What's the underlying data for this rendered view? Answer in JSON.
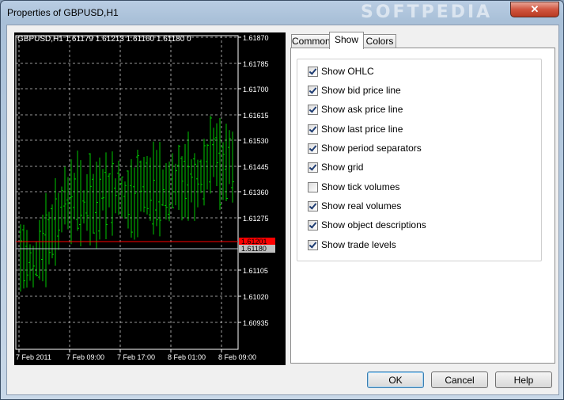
{
  "window": {
    "title": "Properties of GBPUSD,H1",
    "watermark": "SOFTPEDIA",
    "close_label": "✕"
  },
  "chart": {
    "header": "GBPUSD,H1  1.61179 1.61213 1.61160 1.61180  0",
    "price_labels": [
      "1.61870",
      "1.61785",
      "1.61700",
      "1.61615",
      "1.61530",
      "1.61445",
      "1.61360",
      "1.61275",
      "1.61105",
      "1.61020",
      "1.60935"
    ],
    "time_labels": [
      "7 Feb 2011",
      "7 Feb 09:00",
      "7 Feb 17:00",
      "8 Feb 01:00",
      "8 Feb 09:00"
    ],
    "bid_label": "1.61201",
    "last_label": "1.61180",
    "colors": {
      "bars": "#00c800",
      "bid": "#ff0000",
      "grid": "#c8c8c8",
      "background": "#000000"
    }
  },
  "tabs": [
    {
      "label": "Common",
      "active": false
    },
    {
      "label": "Show",
      "active": true
    },
    {
      "label": "Colors",
      "active": false
    }
  ],
  "options": [
    {
      "label": "Show OHLC",
      "checked": true
    },
    {
      "label": "Show bid price line",
      "checked": true
    },
    {
      "label": "Show ask price line",
      "checked": true
    },
    {
      "label": "Show last price line",
      "checked": true
    },
    {
      "label": "Show period separators",
      "checked": true
    },
    {
      "label": "Show grid",
      "checked": true
    },
    {
      "label": "Show tick volumes",
      "checked": false
    },
    {
      "label": "Show real volumes",
      "checked": true
    },
    {
      "label": "Show object descriptions",
      "checked": true
    },
    {
      "label": "Show trade levels",
      "checked": true
    }
  ],
  "buttons": {
    "ok": "OK",
    "cancel": "Cancel",
    "help": "Help"
  }
}
